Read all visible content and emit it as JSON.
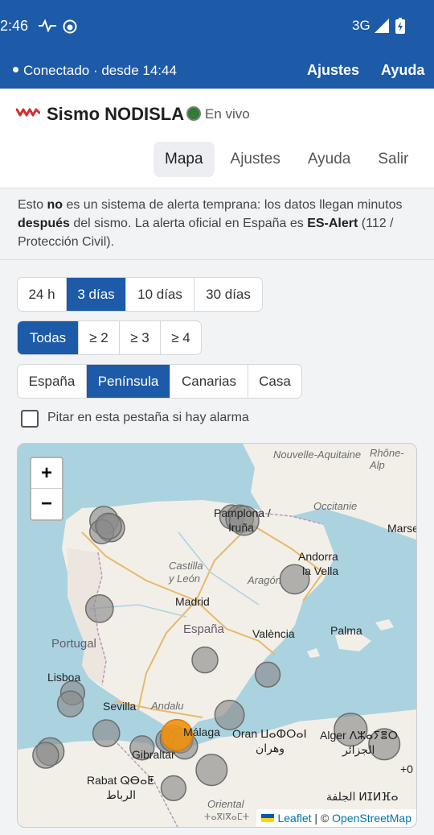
{
  "status_bar": {
    "time": "2:46",
    "network": "3G"
  },
  "app_bar": {
    "connection": "Conectado · desde 14:44",
    "settings": "Ajustes",
    "help": "Ayuda"
  },
  "header": {
    "title": "Sismo NODISLA",
    "live": "En vivo",
    "tabs": [
      {
        "label": "Mapa"
      },
      {
        "label": "Ajustes"
      },
      {
        "label": "Ayuda"
      },
      {
        "label": "Salir"
      }
    ]
  },
  "banner": {
    "p1": "Esto ",
    "b1": "no",
    "p2": " es un sistema de alerta temprana: los datos llegan minutos ",
    "b2": "después",
    "p3": " del sismo. La alerta oficial en España es ",
    "b3": "ES-Alert",
    "p4": " (112 / Protección Civil)."
  },
  "time_filter": {
    "options": [
      "24 h",
      "3 días",
      "10 días",
      "30 días"
    ],
    "selected": "3 días"
  },
  "magnitude_filter": {
    "options": [
      "Todas",
      "≥ 2",
      "≥ 3",
      "≥ 4"
    ],
    "selected": "Todas"
  },
  "region_filter": {
    "options": [
      "España",
      "Península",
      "Canarias",
      "Casa"
    ],
    "selected": "Península"
  },
  "beep_checkbox": {
    "label": "Pitar en esta pestaña si hay alarma",
    "checked": false
  },
  "map": {
    "zoom_in": "+",
    "zoom_out": "−",
    "attribution_leaflet": "Leaflet",
    "attribution_sep": " | © ",
    "attribution_osm": "OpenStreetMap",
    "labels": {
      "nouvelle_aquitaine": "Nouvelle-Aquitaine",
      "rhone_alp": "Rhône-Alp",
      "occitanie": "Occitanie",
      "pamplona": "Pamplona /",
      "iruna": "Iruña",
      "marse": "Marse",
      "andorra": "Andorra",
      "la_vella": "la Vella",
      "castilla": "Castilla",
      "y_leon": "y León",
      "aragon": "Aragón",
      "madrid": "Madrid",
      "espana": "España",
      "portugal": "Portugal",
      "valencia": "València",
      "palma": "Palma",
      "lisboa": "Lisboa",
      "sevilla": "Sevilla",
      "andalu": "Andalu",
      "malaga": "Málaga",
      "oran": "Oran ⵡⴰⵀⵔⴰⵏ",
      "oran_ar": "وهران",
      "alger": "Alger ⴷⵣⴰⵢⴻⵔ",
      "alger_ar": "الجزائر",
      "gibraltar": "Gibraltar",
      "rabat": "Rabat ⵕⴱⴰⵟ",
      "rabat_ar": "الرباط",
      "oriental": "Oriental",
      "oriental_tif": "ⵜⴰⴳⵏⴳⴰⵎⵜ",
      "tunisia_ar": "الجلفة ⵍⵊⵍⴼⴰ",
      "zero": "+0"
    },
    "quakes": [
      {
        "lat": 42.9,
        "lon": -7.4,
        "mag": 2.3,
        "color": "#8c8c8c"
      },
      {
        "lat": 42.7,
        "lon": -7.1,
        "mag": 2.2,
        "color": "#8c8c8c"
      },
      {
        "lat": 42.6,
        "lon": -7.5,
        "mag": 1.8,
        "color": "#8c8c8c"
      },
      {
        "lat": 42.75,
        "lon": -7.2,
        "mag": 2.0,
        "color": "#8c8c8c"
      },
      {
        "lat": 43.0,
        "lon": -1.7,
        "mag": 1.8,
        "color": "#8c8c8c"
      },
      {
        "lat": 42.95,
        "lon": -1.35,
        "mag": 2.2,
        "color": "#8c8c8c"
      },
      {
        "lat": 42.9,
        "lon": -1.15,
        "mag": 2.4,
        "color": "#8c8c8c"
      },
      {
        "lat": 41.3,
        "lon": 1.1,
        "mag": 2.4,
        "color": "#8c8c8c"
      },
      {
        "lat": 40.5,
        "lon": -7.6,
        "mag": 2.2,
        "color": "#8c8c8c"
      },
      {
        "lat": 39.1,
        "lon": -2.9,
        "mag": 2.0,
        "color": "#8c8c8c"
      },
      {
        "lat": 38.7,
        "lon": -0.1,
        "mag": 1.9,
        "color": "#8c8c8c"
      },
      {
        "lat": 38.2,
        "lon": -8.8,
        "mag": 1.8,
        "color": "#8c8c8c"
      },
      {
        "lat": 37.9,
        "lon": -8.9,
        "mag": 2.0,
        "color": "#8c8c8c"
      },
      {
        "lat": 37.6,
        "lon": -1.8,
        "mag": 2.4,
        "color": "#8c8c8c"
      },
      {
        "lat": 37.1,
        "lon": -7.3,
        "mag": 2.1,
        "color": "#8c8c8c"
      },
      {
        "lat": 36.7,
        "lon": -5.7,
        "mag": 1.8,
        "color": "#8c8c8c"
      },
      {
        "lat": 36.6,
        "lon": -9.8,
        "mag": 2.2,
        "color": "#8c8c8c"
      },
      {
        "lat": 36.5,
        "lon": -10.0,
        "mag": 2.0,
        "color": "#8c8c8c"
      },
      {
        "lat": 36.9,
        "lon": -4.55,
        "mag": 1.8,
        "color": "#8c8c8c"
      },
      {
        "lat": 36.95,
        "lon": -4.3,
        "mag": 2.1,
        "color": "#8c8c8c"
      },
      {
        "lat": 36.9,
        "lon": -4.0,
        "mag": 1.9,
        "color": "#8c8c8c"
      },
      {
        "lat": 36.75,
        "lon": -3.8,
        "mag": 2.0,
        "color": "#8c8c8c"
      },
      {
        "lat": 37.05,
        "lon": -4.15,
        "mag": 2.6,
        "color": "#f0920e"
      },
      {
        "lat": 36.1,
        "lon": -2.6,
        "mag": 2.6,
        "color": "#8c8c8c"
      },
      {
        "lat": 35.6,
        "lon": -4.3,
        "mag": 1.9,
        "color": "#8c8c8c"
      },
      {
        "lat": 37.2,
        "lon": 3.6,
        "mag": 2.8,
        "color": "#8c8c8c"
      },
      {
        "lat": 36.8,
        "lon": 5.1,
        "mag": 2.6,
        "color": "#8c8c8c"
      }
    ]
  }
}
